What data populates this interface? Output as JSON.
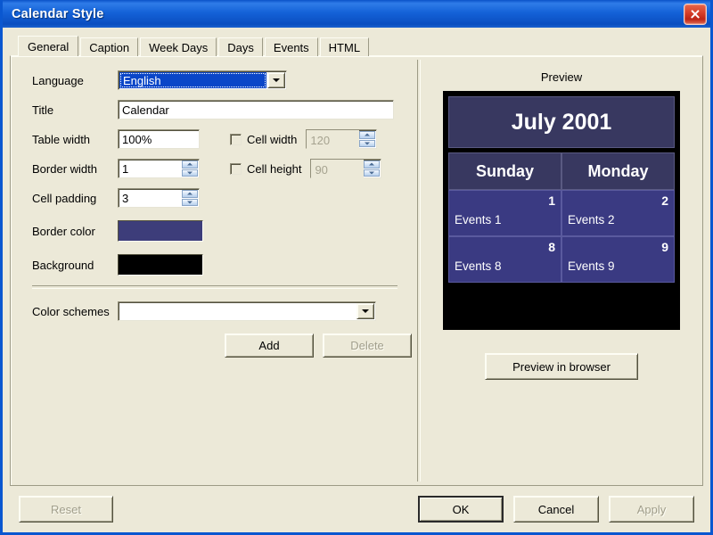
{
  "window": {
    "title": "Calendar Style",
    "close_icon": "close-icon"
  },
  "tabs": [
    {
      "label": "General",
      "active": true
    },
    {
      "label": "Caption",
      "active": false
    },
    {
      "label": "Week Days",
      "active": false
    },
    {
      "label": "Days",
      "active": false
    },
    {
      "label": "Events",
      "active": false
    },
    {
      "label": "HTML",
      "active": false
    }
  ],
  "general": {
    "language": {
      "label": "Language",
      "value": "English",
      "dropdown_icon": "chevron-down-icon"
    },
    "title": {
      "label": "Title",
      "value": "Calendar"
    },
    "table_width": {
      "label": "Table width",
      "value": "100%"
    },
    "border_width": {
      "label": "Border width",
      "value": "1",
      "spinner_up_icon": "spinner-up-icon",
      "spinner_down_icon": "spinner-down-icon"
    },
    "cell_padding": {
      "label": "Cell padding",
      "value": "3",
      "spinner_up_icon": "spinner-up-icon",
      "spinner_down_icon": "spinner-down-icon"
    },
    "cell_width": {
      "label": "Cell width",
      "value": "120",
      "checked": false,
      "enabled": false
    },
    "cell_height": {
      "label": "Cell height",
      "value": "90",
      "checked": false,
      "enabled": false
    },
    "border_color": {
      "label": "Border color",
      "value": "#3d3d7a"
    },
    "background": {
      "label": "Background",
      "value": "#000000"
    },
    "color_schemes": {
      "label": "Color schemes",
      "value": "",
      "dropdown_icon": "chevron-down-icon"
    },
    "add_button": "Add",
    "delete_button": "Delete"
  },
  "preview": {
    "label": "Preview",
    "month_title": "July 2001",
    "weekdays": [
      "Sunday",
      "Monday"
    ],
    "weeks": [
      [
        {
          "day": "1",
          "events": "Events 1"
        },
        {
          "day": "2",
          "events": "Events 2"
        }
      ],
      [
        {
          "day": "8",
          "events": "Events 8"
        },
        {
          "day": "9",
          "events": "Events 9"
        }
      ]
    ],
    "browser_button": "Preview in browser"
  },
  "footer": {
    "reset": "Reset",
    "ok": "OK",
    "cancel": "Cancel",
    "apply": "Apply"
  }
}
